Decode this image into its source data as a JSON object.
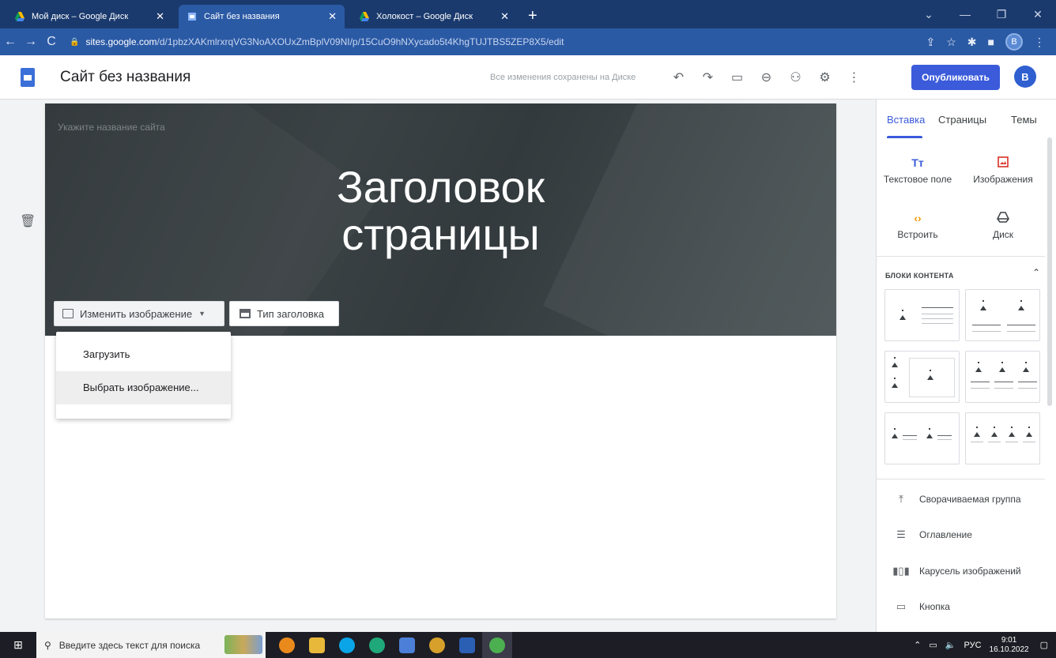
{
  "browser": {
    "tabs": [
      {
        "title": "Мой диск – Google Диск",
        "active": false
      },
      {
        "title": "Сайт без названия",
        "active": true
      },
      {
        "title": "Холокост – Google Диск",
        "active": false
      }
    ],
    "new_tab": "+",
    "url_host": "sites.google.com",
    "url_path": "/d/1pbzXAKmlrxrqVG3NoAXOUxZmBplV09NI/p/15CuO9hNXycado5t4KhgTUJTBS5ZEP8X5/edit",
    "profile_letter": "B"
  },
  "app": {
    "doc_title": "Сайт без названия",
    "saved_status": "Все изменения сохранены на Диске",
    "publish_label": "Опубликовать",
    "avatar_letter": "B"
  },
  "hero": {
    "site_name_placeholder": "Укажите название сайта",
    "title_line1": "Заголовок",
    "title_line2": "страницы",
    "change_image_label": "Изменить изображение",
    "header_type_label": "Тип заголовка"
  },
  "image_menu": {
    "items": [
      "Загрузить",
      "Выбрать изображение..."
    ]
  },
  "panel": {
    "tabs": [
      "Вставка",
      "Страницы",
      "Темы"
    ],
    "insert_items": [
      {
        "icon": "Tт",
        "label": "Текстовое поле"
      },
      {
        "icon": "image-icon",
        "label": "Изображения"
      },
      {
        "icon": "‹›",
        "label": "Встроить"
      },
      {
        "icon": "drive-icon",
        "label": "Диск"
      }
    ],
    "content_blocks_title": "БЛОКИ КОНТЕНТА",
    "list_items": [
      {
        "icon": "collapse-icon",
        "label": "Сворачиваемая группа"
      },
      {
        "icon": "toc-icon",
        "label": "Оглавление"
      },
      {
        "icon": "carousel-icon",
        "label": "Карусель изображений"
      },
      {
        "icon": "button-icon",
        "label": "Кнопка"
      }
    ]
  },
  "taskbar": {
    "search_placeholder": "Введите здесь текст для поиска",
    "lang": "РУС",
    "time": "9:01",
    "date": "16.10.2022"
  },
  "colors": {
    "accent": "#3b5bdb",
    "chrome_tab": "#2b5aa5",
    "chrome_strip": "#1a3a6e",
    "hero_bg": "#373e41"
  }
}
